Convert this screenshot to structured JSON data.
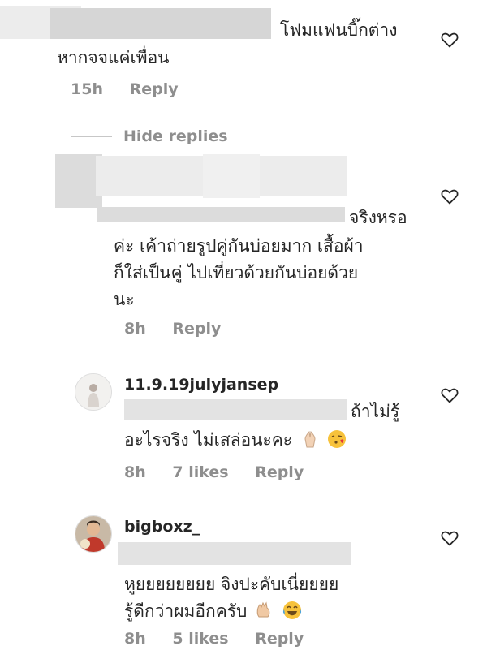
{
  "comments": [
    {
      "text_line1": "โฟมแฟนบิ๊กต่าง",
      "text_line2": "หากจจแค่เพื่อน",
      "time": "15h",
      "reply": "Reply"
    }
  ],
  "hide_replies": "Hide replies",
  "replies": [
    {
      "line1": "จริงหรอ",
      "line2": "ค่ะ เค้าถ่ายรูปคู่กันบ่อยมาก เสื้อผ้า",
      "line3": "ก็ใส่เป็นคู่ ไปเที่ยวด้วยกันบ่อยด้วย",
      "line4": "นะ",
      "time": "8h",
      "reply": "Reply"
    },
    {
      "username": "11.9.19julyjansep",
      "line1": "ถ้าไม่รู้",
      "line2": "อะไรจริง ไม่เสล่อนะคะ",
      "time": "8h",
      "likes": "7 likes",
      "reply": "Reply"
    },
    {
      "username": "bigboxz_",
      "line1": "หูยยยยยยยย  จิงปะคับเนี่ยยยย",
      "line2": "รู้ดีกว่าผมอีกครับ",
      "time": "8h",
      "likes": "5 likes",
      "reply": "Reply"
    }
  ],
  "icons": {
    "heart": "heart-outline-icon",
    "emoji_pray": "folded-hands-icon",
    "emoji_kiss": "face-blowing-kiss-icon",
    "emoji_clap": "clapping-hands-icon",
    "emoji_laugh": "face-with-tears-of-joy-icon"
  }
}
